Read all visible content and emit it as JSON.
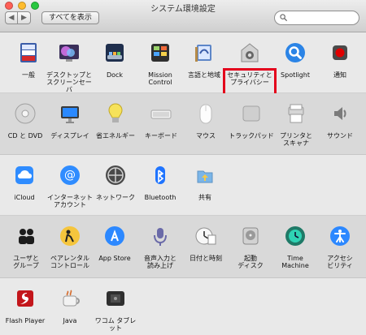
{
  "window": {
    "title": "システム環境設定",
    "show_all": "すべてを表示",
    "nav_back": "◀",
    "nav_forward": "▶"
  },
  "search": {
    "placeholder": ""
  },
  "sections": [
    {
      "items": [
        {
          "label": "一般",
          "icon": "general-icon"
        },
        {
          "label": "デスクトップと\nスクリーンセーバ",
          "icon": "desktop-screensaver-icon"
        },
        {
          "label": "Dock",
          "icon": "dock-icon"
        },
        {
          "label": "Mission\nControl",
          "icon": "mission-control-icon"
        },
        {
          "label": "言語と地域",
          "icon": "language-region-icon"
        },
        {
          "label": "セキュリティと\nプライバシー",
          "icon": "security-privacy-icon"
        },
        {
          "label": "Spotlight",
          "icon": "spotlight-icon"
        },
        {
          "label": "通知",
          "icon": "notifications-icon"
        }
      ]
    },
    {
      "items": [
        {
          "label": "CD と DVD",
          "icon": "cd-dvd-icon"
        },
        {
          "label": "ディスプレイ",
          "icon": "display-icon"
        },
        {
          "label": "省エネルギー",
          "icon": "energy-saver-icon"
        },
        {
          "label": "キーボード",
          "icon": "keyboard-icon"
        },
        {
          "label": "マウス",
          "icon": "mouse-icon"
        },
        {
          "label": "トラックパッド",
          "icon": "trackpad-icon"
        },
        {
          "label": "プリンタと\nスキャナ",
          "icon": "printers-scanners-icon"
        },
        {
          "label": "サウンド",
          "icon": "sound-icon"
        }
      ]
    },
    {
      "items": [
        {
          "label": "iCloud",
          "icon": "icloud-icon"
        },
        {
          "label": "インターネット\nアカウント",
          "icon": "internet-accounts-icon"
        },
        {
          "label": "ネットワーク",
          "icon": "network-icon"
        },
        {
          "label": "Bluetooth",
          "icon": "bluetooth-icon"
        },
        {
          "label": "共有",
          "icon": "sharing-icon"
        }
      ]
    },
    {
      "items": [
        {
          "label": "ユーザと\nグループ",
          "icon": "users-groups-icon"
        },
        {
          "label": "ペアレンタル\nコントロール",
          "icon": "parental-controls-icon"
        },
        {
          "label": "App Store",
          "icon": "app-store-icon"
        },
        {
          "label": "音声入力と\n読み上げ",
          "icon": "dictation-speech-icon"
        },
        {
          "label": "日付と時刻",
          "icon": "date-time-icon"
        },
        {
          "label": "起動\nディスク",
          "icon": "startup-disk-icon"
        },
        {
          "label": "Time\nMachine",
          "icon": "time-machine-icon"
        },
        {
          "label": "アクセシ\nビリティ",
          "icon": "accessibility-icon"
        }
      ]
    },
    {
      "items": [
        {
          "label": "Flash Player",
          "icon": "flash-player-icon"
        },
        {
          "label": "Java",
          "icon": "java-icon"
        },
        {
          "label": "ワコム タブレット",
          "icon": "wacom-tablet-icon"
        }
      ]
    }
  ],
  "highlight_color": "#e3001b"
}
